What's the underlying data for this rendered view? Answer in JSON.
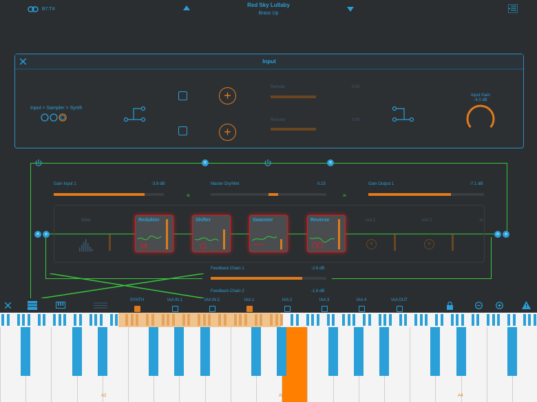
{
  "header": {
    "link_label": "B7:T4",
    "title": "Red Sky Lullaby",
    "subtitle": "Brass Up"
  },
  "input_panel": {
    "title": "Input",
    "source_label": "Input > Sampler > Synth",
    "slider1_label": "Remote",
    "slider1_value": "0.00",
    "slider2_label": "Remote",
    "slider2_value": "0.00",
    "gain_label": "Input Gain",
    "gain_value": "-4.0 dB",
    "gain_fraction": 0.72
  },
  "chain": {
    "gain_input_label": "Gain Input 1",
    "gain_input_value": "-3.8 dB",
    "master_label": "Master Dry/Wet",
    "master_value": "0.15",
    "gain_output_label": "Gain Output 1",
    "gain_output_value": "-7.1 dB",
    "slots": [
      {
        "label": "Bitter",
        "active": false
      },
      {
        "label": "Reduktor",
        "active": true
      },
      {
        "label": "Shifter",
        "active": true
      },
      {
        "label": "Swarmer",
        "active": true
      },
      {
        "label": "Reverse",
        "active": true
      },
      {
        "label": "IAA 1",
        "active": false
      },
      {
        "label": "IAA 2",
        "active": false
      },
      {
        "label": "In",
        "active": false
      }
    ],
    "feedback1_label": "Feedback Chain 1",
    "feedback1_value": "-2.6 dB",
    "feedback2_label": "Feedback Chain 2",
    "feedback2_value": "-1.6 dB"
  },
  "bottombar": {
    "channels": [
      {
        "label": "SYNTH",
        "checked": true
      },
      {
        "label": "IAA IN 1",
        "checked": false
      },
      {
        "label": "IAA IN 2",
        "checked": false
      },
      {
        "label": "IAA 1",
        "checked": true
      },
      {
        "label": "IAA 2",
        "checked": false
      },
      {
        "label": "IAA 3",
        "checked": false
      },
      {
        "label": "IAA 4",
        "checked": false
      },
      {
        "label": "IAA OUT",
        "checked": false
      }
    ]
  },
  "keyboard": {
    "octave_labels": [
      "A2",
      "A3",
      "A4"
    ],
    "pressed_key": "A3"
  },
  "colors": {
    "accent": "#2a9fd8",
    "orange": "#e07b1c",
    "green": "#35c83a",
    "red_glow": "#d02020"
  }
}
